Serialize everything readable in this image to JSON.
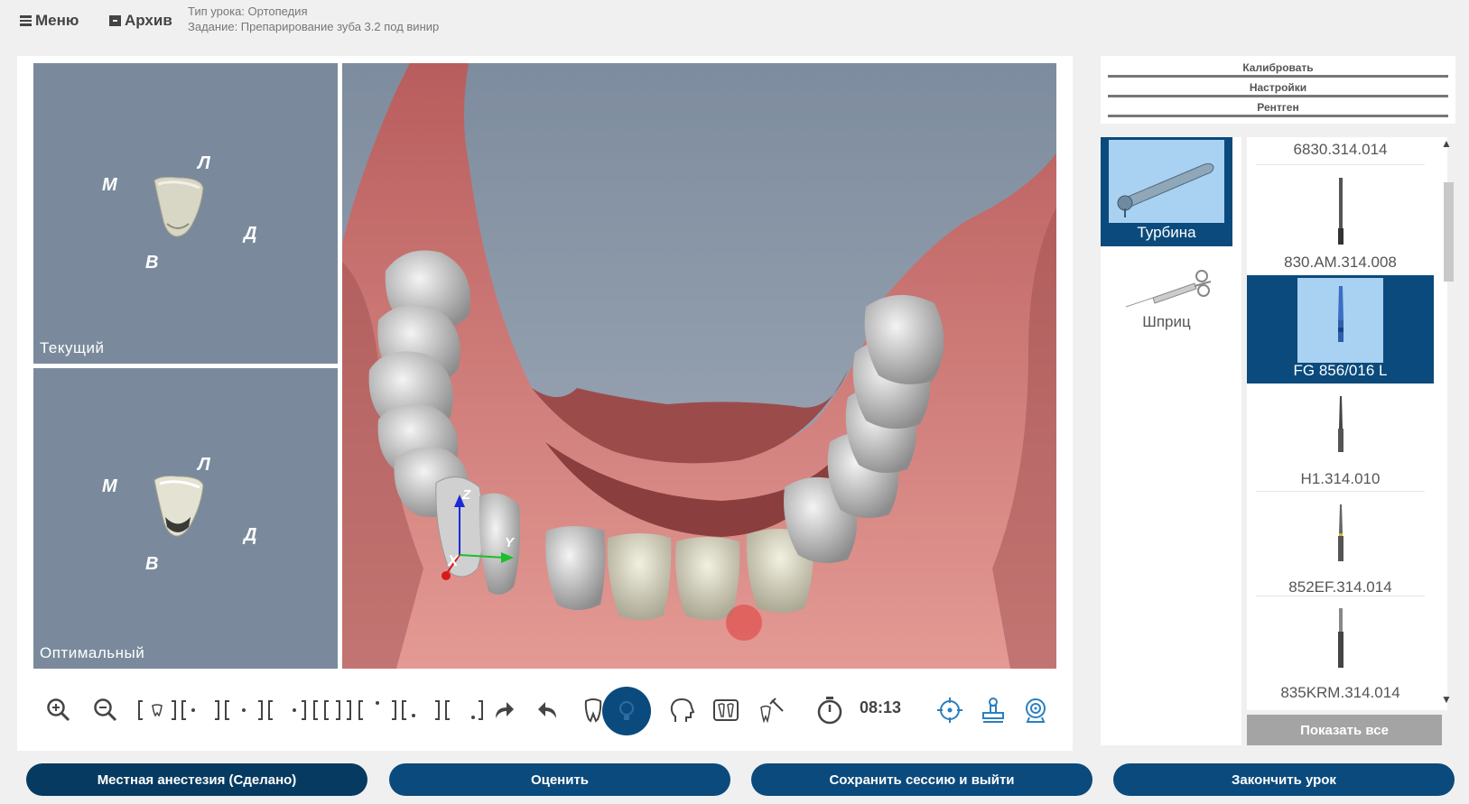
{
  "header": {
    "menu_label": "Меню",
    "archive_label": "Архив",
    "lesson_type": "Тип урока: Ортопедия",
    "task": "Задание: Препарирование зуба 3.2 под винир"
  },
  "views": {
    "current_label": "Текущий",
    "optimal_label": "Оптимальный",
    "directions": {
      "m": "М",
      "l": "Л",
      "d": "Д",
      "v": "В"
    },
    "axes": {
      "x": "X",
      "y": "Y",
      "z": "Z"
    }
  },
  "toolbar": {
    "timer": "08:13",
    "icons": [
      "zoom-in-icon",
      "zoom-out-icon",
      "focus-tooth-icon",
      "view-left-icon",
      "view-center-icon",
      "view-right-icon",
      "view-split-icon",
      "view-top-icon",
      "view-front-icon",
      "view-bottom-icon",
      "redo-icon",
      "undo-icon",
      "tooth-icon",
      "light-icon",
      "head-icon",
      "xray-teeth-icon",
      "tooth-tool-icon",
      "stopwatch-icon",
      "target-icon",
      "stamp-icon",
      "webcam-icon"
    ]
  },
  "right_top": {
    "calibrate": "Калибровать",
    "settings": "Настройки",
    "xray": "Рентген"
  },
  "tools": [
    {
      "label": "Турбина",
      "selected": true
    },
    {
      "label": "Шприц",
      "selected": false
    }
  ],
  "burs": [
    {
      "label": "6830.314.014",
      "selected": false
    },
    {
      "label": "830.AM.314.008",
      "selected": false
    },
    {
      "label": "FG 856/016 L",
      "selected": true
    },
    {
      "label": "H1.314.010",
      "selected": false
    },
    {
      "label": "852EF.314.014",
      "selected": false
    },
    {
      "label": "835KRM.314.014",
      "selected": false
    }
  ],
  "show_all_label": "Показать все",
  "bottom_buttons": {
    "anesthesia": "Местная анестезия (Сделано)",
    "evaluate": "Оценить",
    "save_exit": "Сохранить сессию и выйти",
    "finish": "Закончить урок"
  },
  "colors": {
    "accent": "#0b4a7c",
    "viewport_bg": "#7a8a9c",
    "gum": "#c96a6a",
    "selection_light": "#a9d1f1"
  }
}
